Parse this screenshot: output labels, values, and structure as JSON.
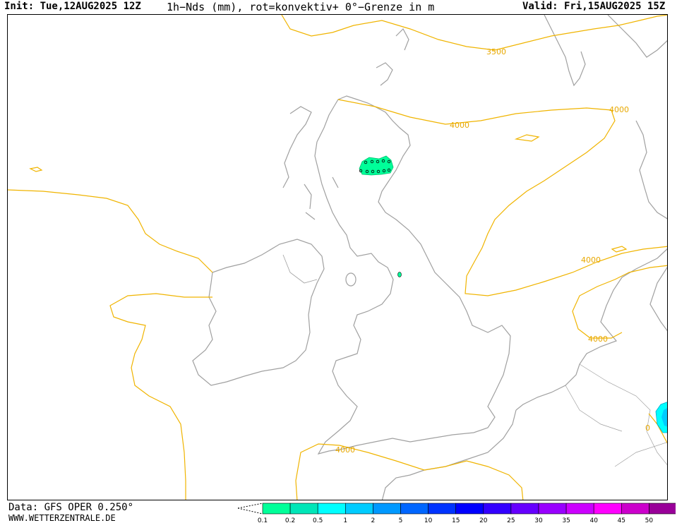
{
  "header": {
    "init": "Init: Tue,12AUG2025 12Z",
    "title": "1h−Nds (mm), rot=konvektiv+ 0°−Grenze in m",
    "valid": "Valid: Fri,15AUG2025 15Z"
  },
  "footer": {
    "data_source": "Data: GFS OPER 0.250°",
    "website": "WWW.WETTERZENTRALE.DE"
  },
  "map": {
    "coast_color": "#a0a0a0",
    "contour_color": "#f0b400",
    "contour_labels": [
      "3500",
      "4000",
      "4000",
      "4000",
      "4000",
      "4000",
      "0"
    ]
  },
  "legend": {
    "values": [
      "0.1",
      "0.2",
      "0.5",
      "1",
      "2",
      "5",
      "10",
      "15",
      "20",
      "25",
      "30",
      "35",
      "40",
      "45",
      "50"
    ],
    "colors": [
      "#00ff99",
      "#00e6b8",
      "#00ffff",
      "#00ccff",
      "#0099ff",
      "#0066ff",
      "#0033ff",
      "#0000ff",
      "#3300ff",
      "#6600ff",
      "#9900ff",
      "#cc00ff",
      "#ff00ff",
      "#cc00cc",
      "#990099",
      "#660066"
    ]
  }
}
